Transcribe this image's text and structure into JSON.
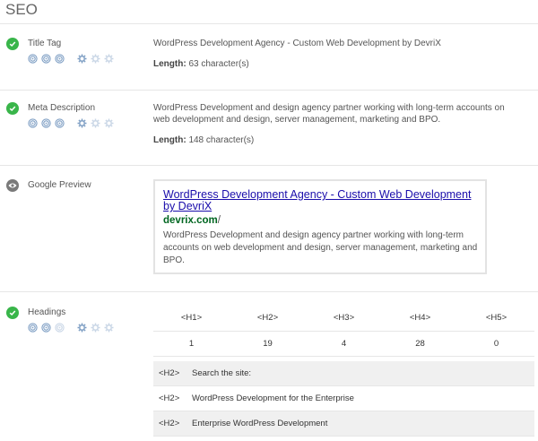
{
  "header": {
    "title": "SEO"
  },
  "rows": {
    "title_tag": {
      "label": "Title Tag",
      "value": "WordPress Development Agency - Custom Web Development by DevriX",
      "length_label": "Length:",
      "length_value": "63 character(s)",
      "status": "ok"
    },
    "meta_description": {
      "label": "Meta Description",
      "value": "WordPress Development and design agency partner working with long-term accounts on web development and design, server management, marketing and BPO.",
      "length_label": "Length:",
      "length_value": "148 character(s)",
      "status": "ok"
    },
    "google_preview": {
      "label": "Google Preview",
      "status": "info",
      "preview": {
        "title": "WordPress Development Agency - Custom Web Development by DevriX",
        "url_domain": "devrix.com",
        "url_path": "/",
        "description": "WordPress Development and design agency partner working with long-term accounts on web development and design, server management, marketing and BPO."
      }
    },
    "headings": {
      "label": "Headings",
      "status": "ok",
      "columns": [
        "<H1>",
        "<H2>",
        "<H3>",
        "<H4>",
        "<H5>"
      ],
      "counts": [
        "1",
        "19",
        "4",
        "28",
        "0"
      ],
      "list": [
        {
          "tag": "<H2>",
          "text": "Search the site:"
        },
        {
          "tag": "<H2>",
          "text": "WordPress Development for the Enterprise"
        },
        {
          "tag": "<H2>",
          "text": "Enterprise WordPress Development"
        }
      ]
    }
  },
  "icons": {
    "status_ok": "check-circle-icon",
    "status_info": "eye-icon",
    "importance": "target-icon",
    "difficulty": "gear-icon"
  },
  "colors": {
    "ok": "#39b54a",
    "info": "#7a7a7a",
    "rating_active": "#7f9fc4",
    "rating_inactive": "#c9d6e6",
    "link": "#1a0dab",
    "url": "#006621"
  }
}
